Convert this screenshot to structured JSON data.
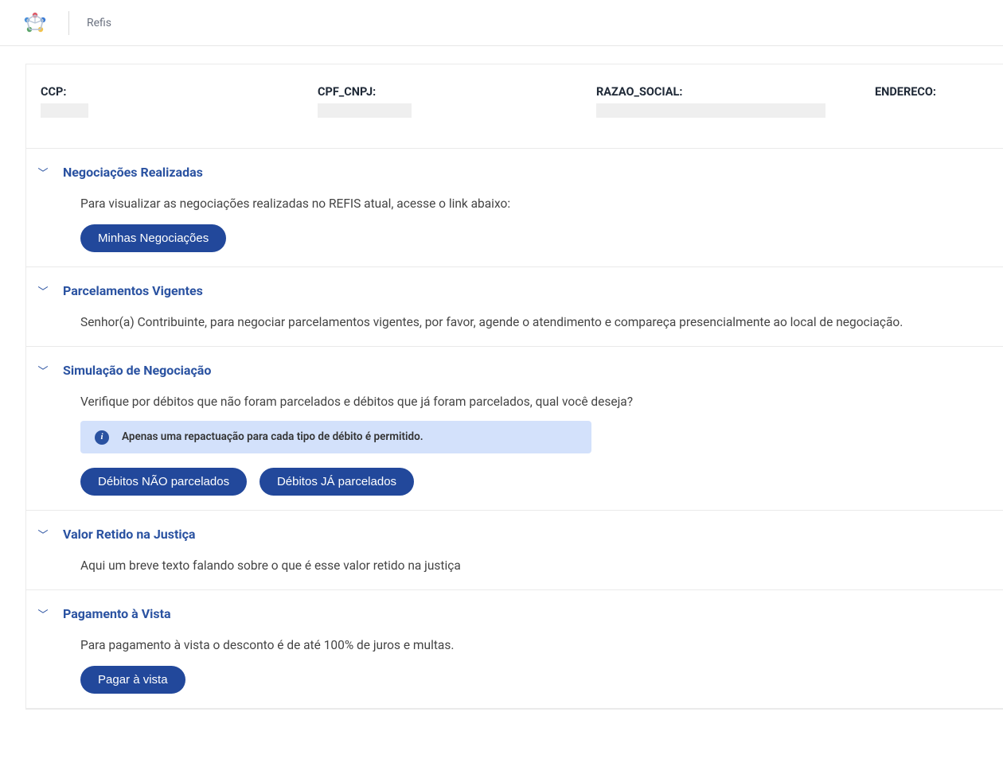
{
  "header": {
    "title": "Refis"
  },
  "info": {
    "ccp_label": "CCP:",
    "cpf_label": "CPF_CNPJ:",
    "razao_label": "RAZAO_SOCIAL:",
    "endereco_label": "ENDERECO:"
  },
  "sections": {
    "negociacoes": {
      "title": "Negociações Realizadas",
      "body": "Para visualizar as negociações realizadas no REFIS atual, acesse o link abaixo:",
      "button": "Minhas Negociações"
    },
    "parcelamentos": {
      "title": "Parcelamentos Vigentes",
      "body": "Senhor(a) Contribuinte, para negociar parcelamentos vigentes, por favor, agende o atendimento e compareça presencialmente ao local de negociação."
    },
    "simulacao": {
      "title": "Simulação de Negociação",
      "body": "Verifique por débitos que não foram parcelados e débitos que já foram parcelados, qual você deseja?",
      "alert": "Apenas uma repactuação para cada tipo de débito é permitido.",
      "button_nao": "Débitos NÃO parcelados",
      "button_ja": "Débitos JÁ parcelados"
    },
    "valor_retido": {
      "title": "Valor Retido na Justiça",
      "body": "Aqui um breve texto falando sobre o que é esse valor retido na justiça"
    },
    "pagamento": {
      "title": "Pagamento à Vista",
      "body": "Para pagamento à vista o desconto é de até 100% de juros e multas.",
      "button": "Pagar à vista"
    }
  }
}
